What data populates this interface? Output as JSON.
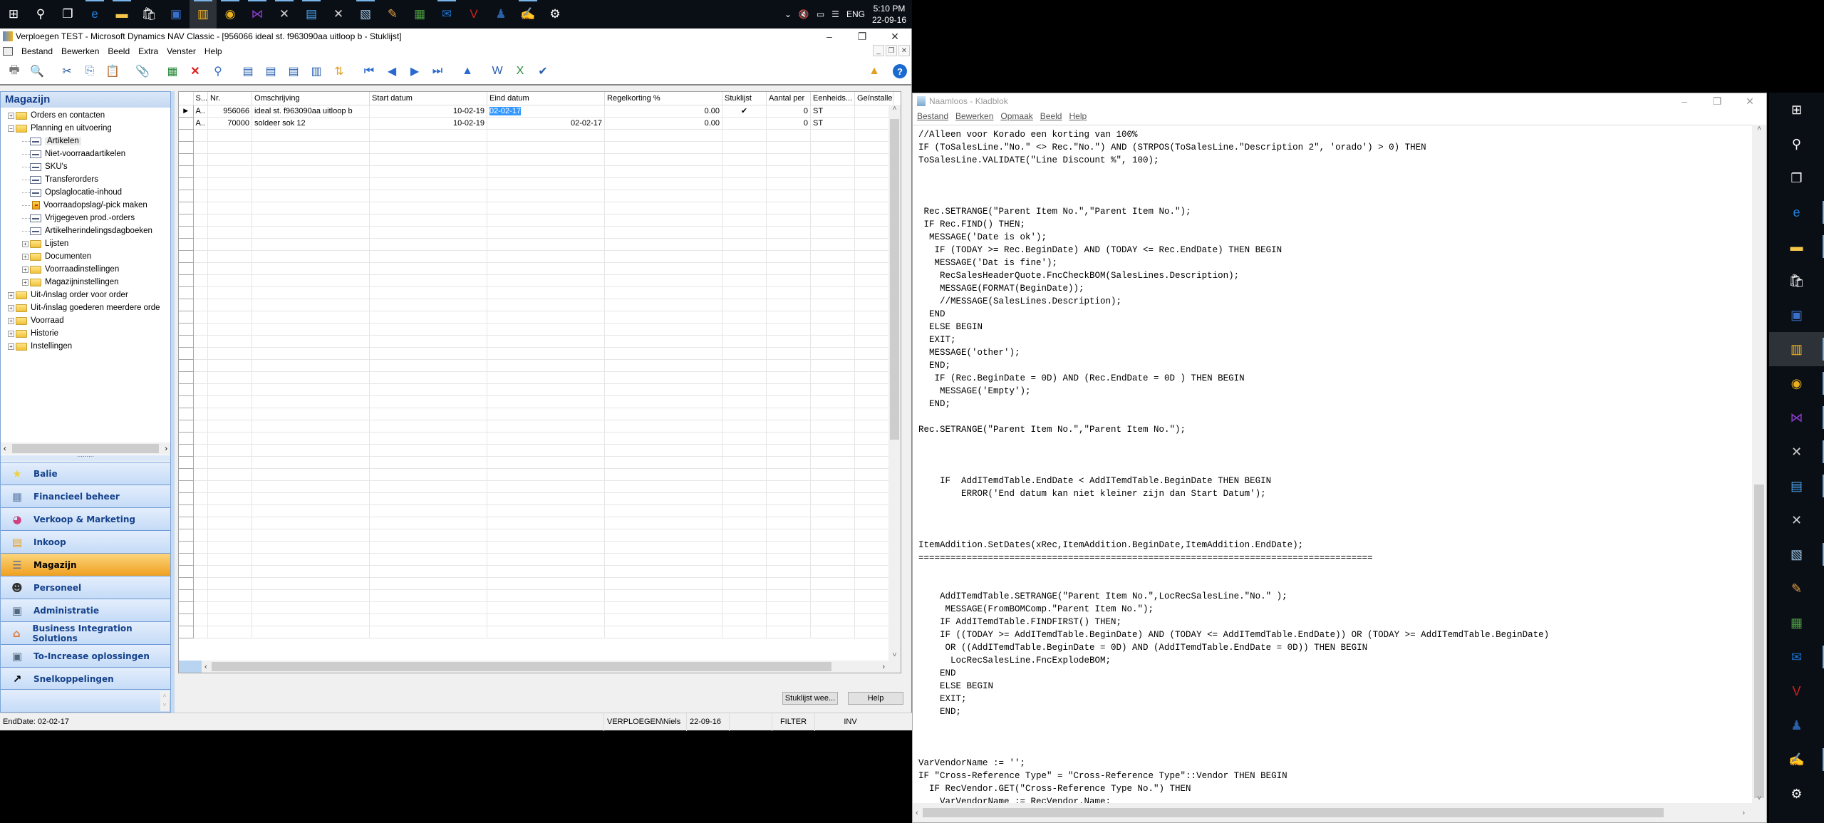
{
  "taskbar": {
    "apps": [
      {
        "icon": "windows-start-icon",
        "glyph": "⊞",
        "color": "#ffffff"
      },
      {
        "icon": "search-icon",
        "glyph": "⚲",
        "color": "#ffffff"
      },
      {
        "icon": "task-view-icon",
        "glyph": "❐",
        "color": "#ffffff"
      },
      {
        "icon": "edge-icon",
        "glyph": "e",
        "color": "#1e7fd8",
        "running": true
      },
      {
        "icon": "file-explorer-icon",
        "glyph": "▬",
        "color": "#f4c74a",
        "running": true
      },
      {
        "icon": "store-icon",
        "glyph": "🛍",
        "color": "#ffffff"
      },
      {
        "icon": "remote-desktop-icon",
        "glyph": "▣",
        "color": "#3a6fc8"
      },
      {
        "icon": "dynamics-nav-icon",
        "glyph": "▥",
        "color": "#f0b020",
        "running": true,
        "active": true
      },
      {
        "icon": "chrome-icon",
        "glyph": "◉",
        "color": "#e8b020",
        "running": true
      },
      {
        "icon": "visual-studio-icon",
        "glyph": "⋈",
        "color": "#8a3cc8",
        "running": true
      },
      {
        "icon": "tools-icon",
        "glyph": "✕",
        "color": "#d0d0d0",
        "running": true
      },
      {
        "icon": "app-window-icon",
        "glyph": "▤",
        "color": "#4aa0e8",
        "running": true
      },
      {
        "icon": "tools-icon-2",
        "glyph": "✕",
        "color": "#d0d0d0"
      },
      {
        "icon": "notepad-icon",
        "glyph": "▧",
        "color": "#9ac0e0",
        "running": true
      },
      {
        "icon": "paint-icon",
        "glyph": "✎",
        "color": "#e8a040"
      },
      {
        "icon": "server-icon",
        "glyph": "▦",
        "color": "#4a9a40"
      },
      {
        "icon": "outlook-icon",
        "glyph": "✉",
        "color": "#1a70c8",
        "running": true
      },
      {
        "icon": "vnc-icon",
        "glyph": "V",
        "color": "#d02020"
      },
      {
        "icon": "user-icon",
        "glyph": "♟",
        "color": "#2a60a8"
      },
      {
        "icon": "notepad-plus-icon",
        "glyph": "✍",
        "color": "#7ab030",
        "running": true
      },
      {
        "icon": "settings-gear-icon",
        "glyph": "⚙",
        "color": "#ffffff"
      }
    ],
    "tray": {
      "lang": "ENG",
      "time": "5:10 PM",
      "date": "22-09-16"
    }
  },
  "nav": {
    "title": "Verploegen TEST - Microsoft Dynamics NAV Classic - [956066 ideal st. f963090aa uitloop b - Stuklijst]",
    "menu": [
      "Bestand",
      "Bewerken",
      "Beeld",
      "Extra",
      "Venster",
      "Help"
    ],
    "pane_title": "Magazijn",
    "tree": [
      {
        "label": "Orders en contacten",
        "type": "folder",
        "level": 0,
        "expander": "+"
      },
      {
        "label": "Planning en uitvoering",
        "type": "folder",
        "level": 0,
        "expander": "−"
      },
      {
        "label": "Artikelen",
        "type": "form",
        "level": 1,
        "selected": true
      },
      {
        "label": "Niet-voorraadartikelen",
        "type": "form",
        "level": 1
      },
      {
        "label": "SKU's",
        "type": "form",
        "level": 1
      },
      {
        "label": "Transferorders",
        "type": "form",
        "level": 1
      },
      {
        "label": "Opslaglocatie-inhoud",
        "type": "form",
        "level": 1
      },
      {
        "label": "Voorraadopslag/-pick maken",
        "type": "report",
        "level": 1
      },
      {
        "label": "Vrijgegeven prod.-orders",
        "type": "form",
        "level": 1
      },
      {
        "label": "Artikelherindelingsdagboeken",
        "type": "form",
        "level": 1
      },
      {
        "label": "Lijsten",
        "type": "folder",
        "level": 1,
        "expander": "+"
      },
      {
        "label": "Documenten",
        "type": "folder",
        "level": 1,
        "expander": "+"
      },
      {
        "label": "Voorraadinstellingen",
        "type": "folder",
        "level": 1,
        "expander": "+"
      },
      {
        "label": "Magazijninstellingen",
        "type": "folder",
        "level": 1,
        "expander": "+"
      },
      {
        "label": "Uit-/inslag order voor order",
        "type": "folder",
        "level": 0,
        "expander": "+"
      },
      {
        "label": "Uit-/inslag goederen meerdere orde",
        "type": "folder",
        "level": 0,
        "expander": "+"
      },
      {
        "label": "Voorraad",
        "type": "folder",
        "level": 0,
        "expander": "+"
      },
      {
        "label": "Historie",
        "type": "folder",
        "level": 0,
        "expander": "+"
      },
      {
        "label": "Instellingen",
        "type": "folder",
        "level": 0,
        "expander": "+"
      }
    ],
    "nav_buttons": [
      {
        "label": "Balie",
        "icon": "star-icon",
        "glyph": "★",
        "color": "#f0d040"
      },
      {
        "label": "Financieel beheer",
        "icon": "ledger-icon",
        "glyph": "▦",
        "color": "#6080a8"
      },
      {
        "label": "Verkoop & Marketing",
        "icon": "chart-icon",
        "glyph": "◕",
        "color": "#d04080"
      },
      {
        "label": "Inkoop",
        "icon": "purchase-icon",
        "glyph": "▤",
        "color": "#e8a020"
      },
      {
        "label": "Magazijn",
        "icon": "warehouse-icon",
        "glyph": "☰",
        "color": "#607090",
        "active": true
      },
      {
        "label": "Personeel",
        "icon": "people-icon",
        "glyph": "☻",
        "color": "#303030"
      },
      {
        "label": "Administratie",
        "icon": "computer-icon",
        "glyph": "▣",
        "color": "#506880"
      },
      {
        "label": "Business Integration Solutions",
        "icon": "house-icon",
        "glyph": "⌂",
        "color": "#e07830"
      },
      {
        "label": "To-Increase oplossingen",
        "icon": "computer-icon",
        "glyph": "▣",
        "color": "#506880"
      },
      {
        "label": "Snelkoppelingen",
        "icon": "shortcut-arrow-icon",
        "glyph": "↗",
        "color": "#000000"
      }
    ],
    "grid": {
      "columns": [
        "S...",
        "Nr.",
        "Omschrijving",
        "Start datum",
        "Eind datum",
        "Regelkorting %",
        "Stuklijst",
        "Aantal per",
        "Eenheids...",
        "Geïnstalle"
      ],
      "rows": [
        {
          "marker": "▶",
          "s": "A..",
          "nr": "956066",
          "desc": "ideal st. f963090aa uitloop b",
          "start": "10-02-19",
          "end": "02-02-17",
          "end_selected": true,
          "disc": "0.00",
          "bom": "✔",
          "qty": "0",
          "unit": "ST",
          "inst": ""
        },
        {
          "marker": "",
          "s": "A..",
          "nr": "70000",
          "desc": "soldeer sok 12",
          "start": "10-02-19",
          "end": "02-02-17",
          "end_selected": false,
          "disc": "0.00",
          "bom": "",
          "qty": "0",
          "unit": "ST",
          "inst": ""
        }
      ]
    },
    "buttons": {
      "bom_view": "Stuklijst wee...",
      "help": "Help"
    },
    "status": {
      "field": "EndDate: 02-02-17",
      "user": "VERPLOEGEN\\Niels",
      "date": "22-09-16",
      "filter": "FILTER",
      "ins": "INV"
    }
  },
  "notepad": {
    "title": "Naamloos - Kladblok",
    "menu": [
      "Bestand",
      "Bewerken",
      "Opmaak",
      "Beeld",
      "Help"
    ],
    "text": "//Alleen voor Korado een korting van 100%\nIF (ToSalesLine.\"No.\" <> Rec.\"No.\") AND (STRPOS(ToSalesLine.\"Description 2\", 'orado') > 0) THEN\nToSalesLine.VALIDATE(\"Line Discount %\", 100);\n\n\n\n Rec.SETRANGE(\"Parent Item No.\",\"Parent Item No.\");\n IF Rec.FIND() THEN;\n  MESSAGE('Date is ok');\n   IF (TODAY >= Rec.BeginDate) AND (TODAY <= Rec.EndDate) THEN BEGIN\n   MESSAGE('Dat is fine');\n    RecSalesHeaderQuote.FncCheckBOM(SalesLines.Description);\n    MESSAGE(FORMAT(BeginDate));\n    //MESSAGE(SalesLines.Description);\n  END\n  ELSE BEGIN\n  EXIT;\n  MESSAGE('other');\n  END;\n   IF (Rec.BeginDate = 0D) AND (Rec.EndDate = 0D ) THEN BEGIN\n    MESSAGE('Empty');\n  END;\n\nRec.SETRANGE(\"Parent Item No.\",\"Parent Item No.\");\n\n\n\n    IF  AddITemdTable.EndDate < AddITemdTable.BeginDate THEN BEGIN\n        ERROR('End datum kan niet kleiner zijn dan Start Datum');\n\n\n\nItemAddition.SetDates(xRec,ItemAddition.BeginDate,ItemAddition.EndDate);\n=====================================================================================\n\n\n    AddITemdTable.SETRANGE(\"Parent Item No.\",LocRecSalesLine.\"No.\" );\n     MESSAGE(FromBOMComp.\"Parent Item No.\");\n    IF AddITemdTable.FINDFIRST() THEN;\n    IF ((TODAY >= AddITemdTable.BeginDate) AND (TODAY <= AddITemdTable.EndDate)) OR (TODAY >= AddITemdTable.BeginDate)\n     OR ((AddITemdTable.BeginDate = 0D) AND (AddITemdTable.EndDate = 0D)) THEN BEGIN\n      LocRecSalesLine.FncExplodeBOM;\n    END\n    ELSE BEGIN\n    EXIT;\n    END;\n\n\n\nVarVendorName := '';\nIF \"Cross-Reference Type\" = \"Cross-Reference Type\"::Vendor THEN BEGIN\n  IF RecVendor.GET(\"Cross-Reference Type No.\") THEN\n    VarVendorName := RecVendor.Name;"
  },
  "vtaskbar": {
    "apps": [
      {
        "icon": "windows-start-icon",
        "glyph": "⊞",
        "color": "#ffffff"
      },
      {
        "icon": "search-icon",
        "glyph": "⚲",
        "color": "#ffffff"
      },
      {
        "icon": "task-view-icon",
        "glyph": "❐",
        "color": "#ffffff"
      },
      {
        "icon": "edge-icon",
        "glyph": "e",
        "color": "#1e7fd8",
        "running": true
      },
      {
        "icon": "file-explorer-icon",
        "glyph": "▬",
        "color": "#f4c74a",
        "running": true
      },
      {
        "icon": "store-icon",
        "glyph": "🛍",
        "color": "#ffffff"
      },
      {
        "icon": "remote-desktop-icon",
        "glyph": "▣",
        "color": "#3a6fc8"
      },
      {
        "icon": "dynamics-nav-icon",
        "glyph": "▥",
        "color": "#f0b020",
        "running": true,
        "active": true
      },
      {
        "icon": "chrome-icon",
        "glyph": "◉",
        "color": "#e8b020",
        "running": true
      },
      {
        "icon": "visual-studio-icon",
        "glyph": "⋈",
        "color": "#8a3cc8",
        "running": true
      },
      {
        "icon": "tools-icon",
        "glyph": "✕",
        "color": "#d0d0d0",
        "running": true
      },
      {
        "icon": "app-window-icon",
        "glyph": "▤",
        "color": "#4aa0e8",
        "running": true
      },
      {
        "icon": "tools-icon-2",
        "glyph": "✕",
        "color": "#d0d0d0"
      },
      {
        "icon": "notepad-icon",
        "glyph": "▧",
        "color": "#9ac0e0",
        "running": true
      },
      {
        "icon": "paint-icon",
        "glyph": "✎",
        "color": "#e8a040"
      },
      {
        "icon": "server-icon",
        "glyph": "▦",
        "color": "#4a9a40"
      },
      {
        "icon": "outlook-icon",
        "glyph": "✉",
        "color": "#1a70c8",
        "running": true
      },
      {
        "icon": "vnc-icon",
        "glyph": "V",
        "color": "#d02020"
      },
      {
        "icon": "user-icon",
        "glyph": "♟",
        "color": "#2a60a8"
      },
      {
        "icon": "notepad-plus-icon",
        "glyph": "✍",
        "color": "#7ab030",
        "running": true
      },
      {
        "icon": "settings-gear-icon",
        "glyph": "⚙",
        "color": "#ffffff"
      }
    ]
  }
}
